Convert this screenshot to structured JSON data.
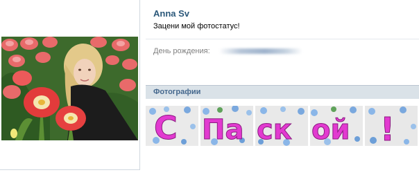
{
  "profile": {
    "name": "Anna Sv",
    "status": "Зацени мой фотостатус!",
    "avatar_icon": "profile-photo"
  },
  "info": {
    "birthday_label": "День рождения:",
    "birthday_value": ""
  },
  "photos": {
    "section_title": "Фотографии",
    "banner_text": "С Пасхой!",
    "thumbnails": [
      {
        "letters": "С"
      },
      {
        "letters": "Па"
      },
      {
        "letters": "ск"
      },
      {
        "letters": "ой"
      },
      {
        "letters": "!"
      }
    ]
  },
  "colors": {
    "link": "#2b587a",
    "section_bg": "#dae2e8",
    "banner_pink": "#e23ad0"
  }
}
